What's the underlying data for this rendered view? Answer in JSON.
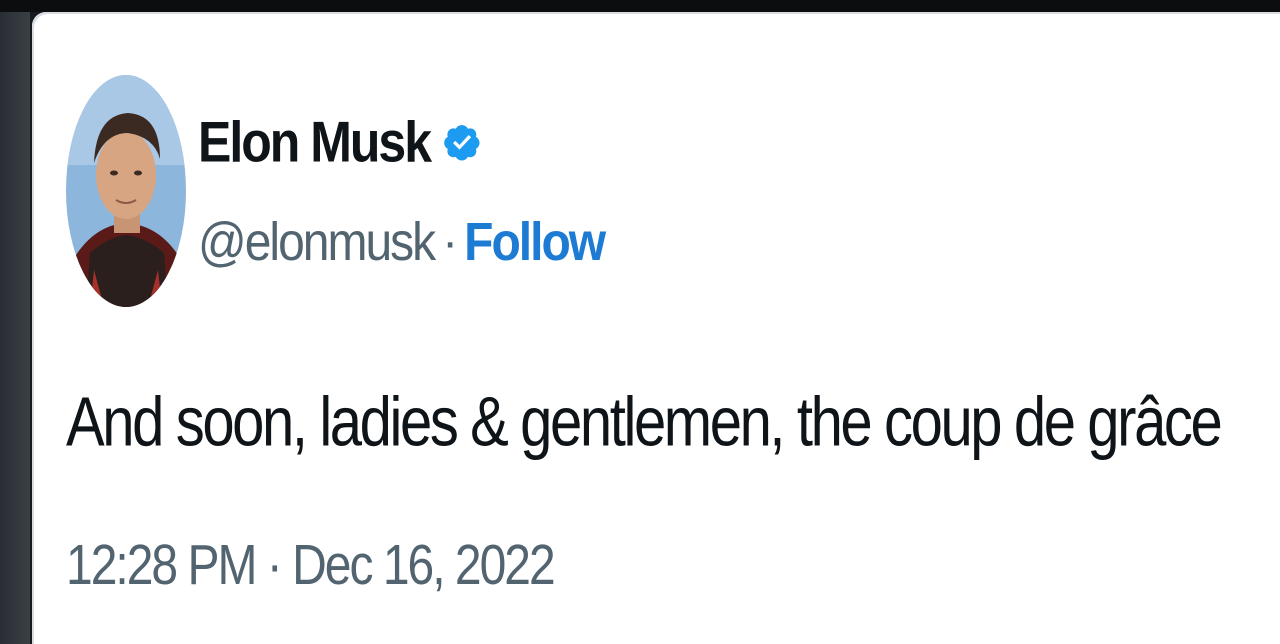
{
  "tweet": {
    "author": {
      "display_name": "Elon Musk",
      "handle": "@elonmusk",
      "verified_icon": "verified-badge-icon",
      "avatar_icon": "avatar"
    },
    "separator": "·",
    "follow_label": "Follow",
    "text": "And soon, ladies & gentlemen, the coup de grâce",
    "time": "12:28 PM",
    "date": "Dec 16, 2022"
  },
  "colors": {
    "text_primary": "#0f1419",
    "text_secondary": "#536471",
    "accent": "#1d7bd4",
    "badge": "#1d9bf0",
    "card_bg": "#ffffff"
  }
}
